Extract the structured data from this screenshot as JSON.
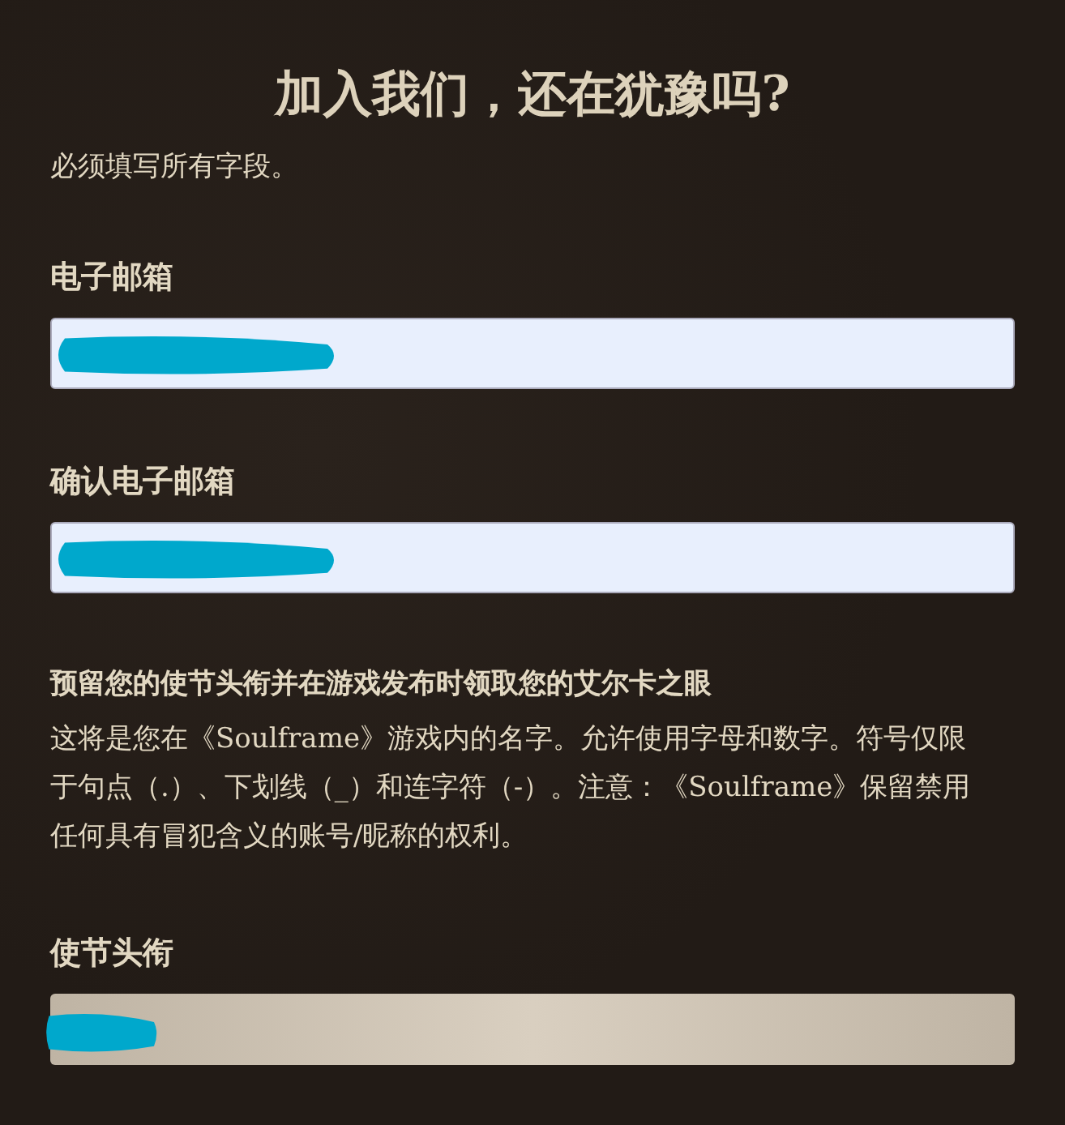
{
  "title": "加入我们，还在犹豫吗?",
  "note": "必须填写所有字段。",
  "sections": [
    {
      "kind": "field",
      "label": "电子邮箱",
      "field": {
        "kind": "email",
        "redacted": true
      }
    },
    {
      "kind": "field",
      "label": "确认电子邮箱",
      "field": {
        "kind": "email",
        "redacted": true
      }
    },
    {
      "kind": "info",
      "heading": "预留您的使节头衔并在游戏发布时领取您的艾尔卡之眼",
      "text": "这将是您在《Soulframe》游戏内的名字。允许使用字母和数字。符号仅限于句点（.）、下划线（_）和连字符（-）。注意：《Soulframe》保留禁用任何具有冒犯含义的账号/昵称的权利。"
    },
    {
      "kind": "field",
      "label": "使节头衔",
      "field": {
        "kind": "parchment",
        "redacted": true
      }
    }
  ]
}
